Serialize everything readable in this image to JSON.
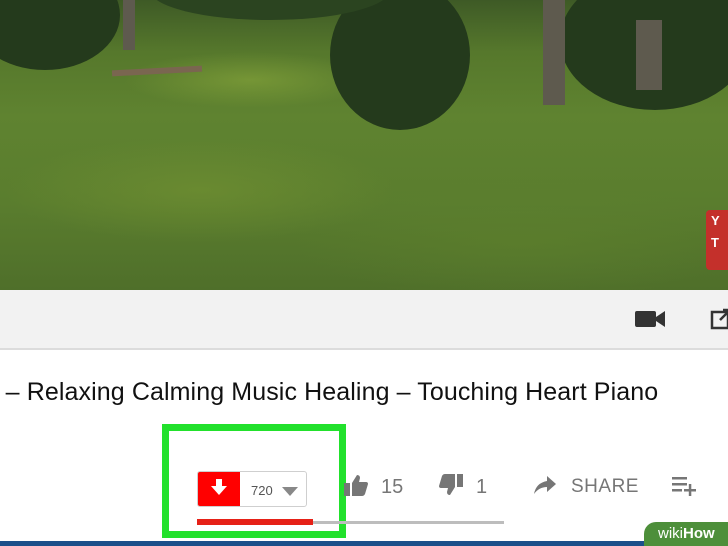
{
  "video": {
    "badge_text": "Y\nT"
  },
  "controls": {
    "camera_icon": "video-camera-icon",
    "popout_icon": "popout-icon"
  },
  "title": "c – Relaxing Calming Music Healing – Touching Heart Piano",
  "actions": {
    "download": {
      "icon": "download-arrow-icon",
      "quality": "720",
      "caret_icon": "chevron-down-icon",
      "color": "#ff0000"
    },
    "like": {
      "icon": "thumbs-up-icon",
      "count": "15"
    },
    "dislike": {
      "icon": "thumbs-down-icon",
      "count": "1"
    },
    "share": {
      "icon": "share-arrow-icon",
      "label": "SHARE"
    },
    "add_to": {
      "icon": "add-to-playlist-icon"
    },
    "highlight_color": "#22e12c"
  },
  "watermark": {
    "wiki": "wiki",
    "how": "How"
  }
}
